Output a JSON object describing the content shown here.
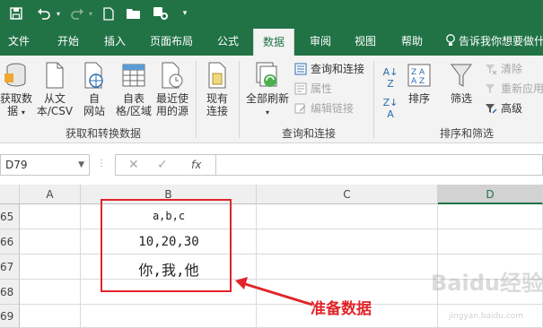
{
  "tabs": [
    {
      "label": "文件",
      "active": false
    },
    {
      "label": "开始",
      "active": false
    },
    {
      "label": "插入",
      "active": false
    },
    {
      "label": "页面布局",
      "active": false
    },
    {
      "label": "公式",
      "active": false
    },
    {
      "label": "数据",
      "active": true
    },
    {
      "label": "审阅",
      "active": false
    },
    {
      "label": "视图",
      "active": false
    },
    {
      "label": "帮助",
      "active": false
    }
  ],
  "tell_me": "告诉我你想要做什",
  "ribbon": {
    "get_data": {
      "label_line1": "获取数",
      "label_line2": "据"
    },
    "from_text": {
      "label_line1": "从文",
      "label_line2": "本/CSV"
    },
    "from_web": {
      "label_line1": "自",
      "label_line2": "网站"
    },
    "from_table": {
      "label_line1": "自表",
      "label_line2": "格/区域"
    },
    "recent_sources": {
      "label_line1": "最近使",
      "label_line2": "用的源"
    },
    "existing_conn": {
      "label_line1": "现有",
      "label_line2": "连接"
    },
    "group1_label": "获取和转换数据",
    "refresh_all": {
      "label": "全部刷新"
    },
    "queries_conn": "查询和连接",
    "properties": "属性",
    "edit_links": "编辑链接",
    "group2_label": "查询和连接",
    "sort": "排序",
    "filter": "筛选",
    "clear": "清除",
    "reapply": "重新应用",
    "advanced": "高级",
    "group3_label": "排序和筛选"
  },
  "formula_bar": {
    "name_box": "D79",
    "cancel": "✕",
    "enter": "✓",
    "fx": "fx",
    "formula": ""
  },
  "grid": {
    "columns": [
      "A",
      "B",
      "C",
      "D"
    ],
    "selected_column": "D",
    "rows": [
      "65",
      "66",
      "67",
      "68",
      "69"
    ],
    "cells": {
      "b65": "a,b,c",
      "b66": "10,20,30",
      "b67": "你,我,他"
    }
  },
  "annotation": {
    "label": "准备数据",
    "color": "#e0252a"
  },
  "watermark": {
    "main": "Baidu经验",
    "sub": "jingyan.baidu.com"
  },
  "colors": {
    "excel_green": "#217346",
    "ribbon_bg": "#f3f3f3"
  }
}
